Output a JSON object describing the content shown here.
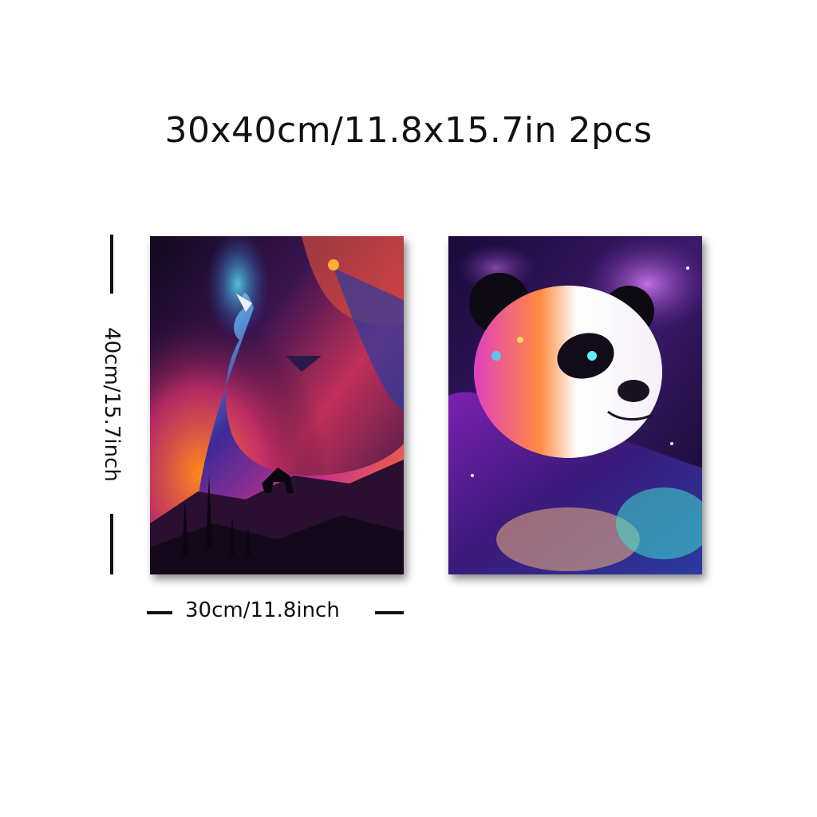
{
  "product": {
    "title": "30x40cm/11.8x15.7in 2pcs",
    "height_label": "40cm/15.7inch",
    "width_label": "30cm/11.8inch"
  },
  "paintings": [
    {
      "subject": "wolf-painting"
    },
    {
      "subject": "panda-painting"
    }
  ],
  "colors": {
    "text": "#111111",
    "background": "#ffffff"
  }
}
